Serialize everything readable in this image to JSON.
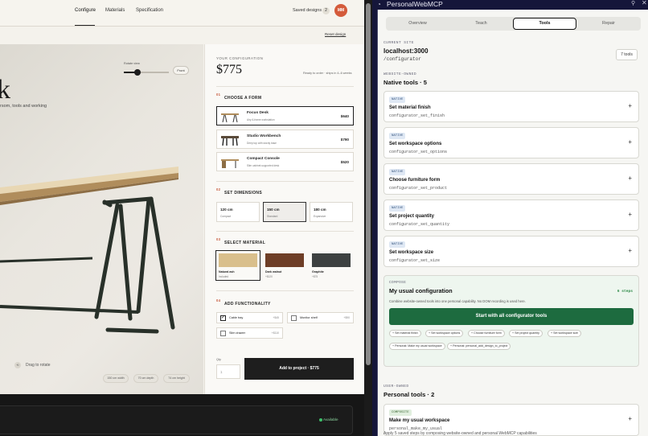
{
  "nav": {
    "links": [
      "Configure",
      "Materials",
      "Specification"
    ],
    "saved_label": "Saved designs",
    "saved_count": "2",
    "avatar": "MM",
    "reset": "Reset design"
  },
  "scene": {
    "big_letter": "k",
    "subtitle": "rsom, tools and working",
    "rotate_label": "Rotate view",
    "rotate_value": 0.3,
    "front_label": "Front",
    "drag_label": "Drag to rotate",
    "dimensions": [
      "150 cm width",
      "70 cm depth",
      "74 cm height"
    ]
  },
  "config": {
    "label": "YOUR CONFIGURATION",
    "price": "$775",
    "ready": "Ready to order · ships in 4–6 weeks",
    "sections": [
      {
        "num": "01",
        "title": "CHOOSE A FORM"
      },
      {
        "num": "02",
        "title": "SET DIMENSIONS"
      },
      {
        "num": "03",
        "title": "SELECT MATERIAL"
      },
      {
        "num": "04",
        "title": "ADD FUNCTIONALITY"
      }
    ],
    "forms": [
      {
        "name": "Focus Desk",
        "desc": "Airy A-frame workstation",
        "price": "$640"
      },
      {
        "name": "Studio Workbench",
        "desc": "Deep top with sturdy base",
        "price": "$790"
      },
      {
        "name": "Compact Console",
        "desc": "Slim cabinet-supported desk",
        "price": "$520"
      }
    ],
    "sizes": [
      {
        "value": "120 cm",
        "label": "Compact"
      },
      {
        "value": "150 cm",
        "label": "Standard"
      },
      {
        "value": "180 cm",
        "label": "Expansive"
      }
    ],
    "materials": [
      {
        "name": "Natural ash",
        "price": "Included",
        "color": "#d9bf8c"
      },
      {
        "name": "Dark walnut",
        "price": "+$120",
        "color": "#6e3e27"
      },
      {
        "name": "Graphite",
        "price": "+$75",
        "color": "#3d4141"
      }
    ],
    "addons": [
      {
        "name": "Cable tray",
        "price": "+$45",
        "checked": true
      },
      {
        "name": "Monitor shelf",
        "price": "+$90",
        "checked": false
      },
      {
        "name": "Slim drawer",
        "price": "+$110",
        "checked": false
      }
    ],
    "qty_label": "Qty",
    "qty_value": "1",
    "add_button": "Add to project · $775"
  },
  "bottom": {
    "available": "Available"
  },
  "ext": {
    "title": "PersonalWebMCP",
    "tabs": [
      "Overview",
      "Teach",
      "Tools",
      "Repair"
    ],
    "current_site_label": "CURRENT SITE",
    "host": "localhost:3000",
    "path": "/configurator",
    "tools_badge": "7 tools",
    "owned_label": "WEBSITE-OWNED",
    "native_heading": "Native tools · 5",
    "native_tools": [
      {
        "badge": "NATIVE",
        "name": "Set material finish",
        "id": "configurator_set_finish"
      },
      {
        "badge": "NATIVE",
        "name": "Set workspace options",
        "id": "configurator_set_options"
      },
      {
        "badge": "NATIVE",
        "name": "Choose furniture form",
        "id": "configurator_set_product"
      },
      {
        "badge": "NATIVE",
        "name": "Set project quantity",
        "id": "configurator_set_quantity"
      },
      {
        "badge": "NATIVE",
        "name": "Set workspace size",
        "id": "configurator_set_size"
      }
    ],
    "compose": {
      "label": "COMPOSE",
      "title": "My usual configuration",
      "steps": "6 steps",
      "desc": "Combine website-owned tools into one personal capability. No DOM recording is used here.",
      "start": "Start with all configurator tools",
      "chips": [
        "+ Set material finish",
        "+ Set workspace options",
        "+ Choose furniture form",
        "+ Set project quantity",
        "+ Set workspace size",
        "+ Personal: Make my usual workspace",
        "+ Personal: personal_add_design_to_project"
      ]
    },
    "user_label": "USER-OWNED",
    "personal_heading": "Personal tools · 2",
    "personal_tool": {
      "badge": "COMPOSITE",
      "name": "Make my usual workspace",
      "id": "personal_make_my_usual"
    },
    "bottom_text": "Apply 5 saved steps by composing website-owned and personal WebMCP capabilities"
  }
}
